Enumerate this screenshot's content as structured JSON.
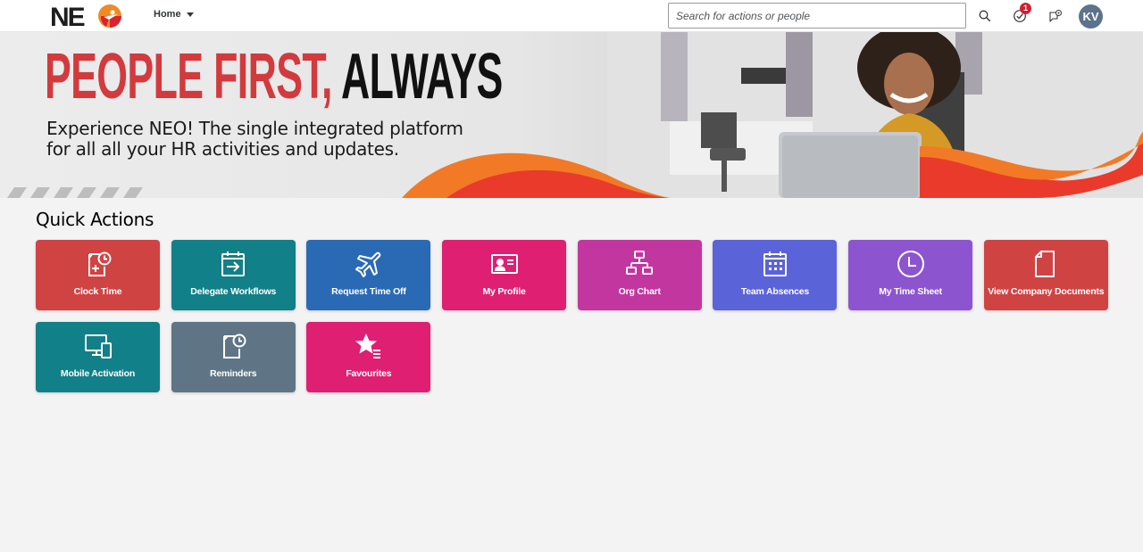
{
  "header": {
    "logo_text": "NEO",
    "home_menu_label": "Home",
    "search_placeholder": "Search for actions or people",
    "search_value": "",
    "notifications_count": "1",
    "avatar_initials": "KV"
  },
  "banner": {
    "headline_red": "PEOPLE FIRST,",
    "headline_black": "ALWAYS",
    "subline_1": "Experience NEO! The single integrated platform",
    "subline_2": "for all all your HR activities and updates."
  },
  "quick_actions": {
    "title": "Quick Actions",
    "tiles": [
      {
        "label": "Clock Time",
        "icon": "clock-time-icon",
        "color": "#d04343"
      },
      {
        "label": "Delegate Workflows",
        "icon": "delegate-calendar-icon",
        "color": "#128088"
      },
      {
        "label": "Request Time Off",
        "icon": "airplane-icon",
        "color": "#2a6ab4"
      },
      {
        "label": "My Profile",
        "icon": "profile-card-icon",
        "color": "#de1f72"
      },
      {
        "label": "Org Chart",
        "icon": "org-chart-icon",
        "color": "#c236a0"
      },
      {
        "label": "Team Absences",
        "icon": "calendar-icon",
        "color": "#5b63d9"
      },
      {
        "label": "My Time Sheet",
        "icon": "clock-icon",
        "color": "#8c55cf"
      },
      {
        "label": "View Company Documents",
        "icon": "document-icon",
        "color": "#d04343"
      },
      {
        "label": "Mobile Activation",
        "icon": "devices-icon",
        "color": "#128088"
      },
      {
        "label": "Reminders",
        "icon": "reminder-icon",
        "color": "#5f7585"
      },
      {
        "label": "Favourites",
        "icon": "favourites-icon",
        "color": "#de1f72"
      }
    ]
  }
}
